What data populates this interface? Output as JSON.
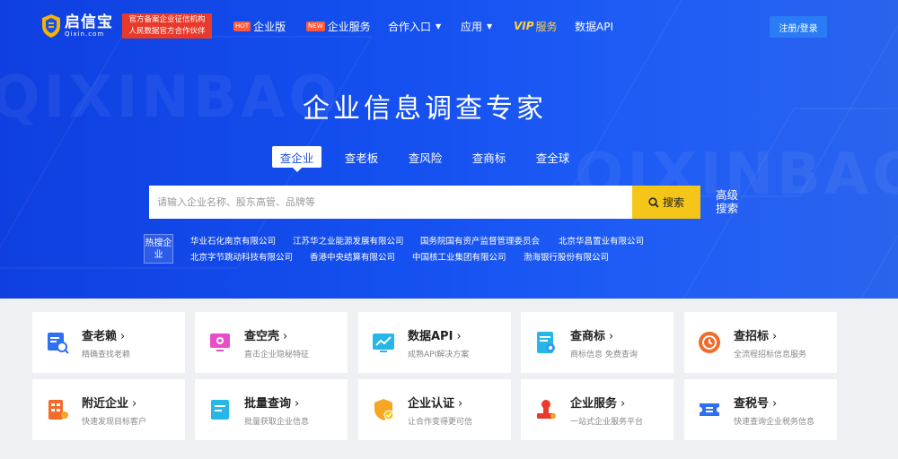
{
  "header": {
    "logo_cn": "启信宝",
    "logo_en": "Qixin.com",
    "tag_line1": "官方备案企业征信机构",
    "tag_line2": "人民数据官方合作伙伴",
    "nav": [
      {
        "badge": "HOT",
        "label": "企业版"
      },
      {
        "badge": "NEW",
        "label": "企业服务"
      },
      {
        "label": "合作入口"
      },
      {
        "label": "应用"
      },
      {
        "vip": "VIP",
        "label": "服务"
      },
      {
        "label": "数据API"
      }
    ],
    "login": "注册/登录"
  },
  "hero": {
    "title": "企业信息调查专家",
    "watermark1": "QIXINBAO",
    "watermark2": "QIXINBAO"
  },
  "tabs": [
    "查企业",
    "查老板",
    "查风险",
    "查商标",
    "查全球"
  ],
  "search": {
    "placeholder": "请输入企业名称、股东高管、品牌等",
    "button": "搜索",
    "advanced": "高级搜索"
  },
  "hot": {
    "tag": "热搜企业",
    "row1": [
      "华业石化南京有限公司",
      "江苏华之业能源发展有限公司",
      "国务院国有资产监督管理委员会",
      "北京华昌置业有限公司"
    ],
    "row2": [
      "北京字节跳动科技有限公司",
      "香港中央结算有限公司",
      "中国核工业集团有限公司",
      "渤海银行股份有限公司"
    ]
  },
  "cards": [
    {
      "title": "查老赖",
      "desc": "精确查找老赖",
      "icon": "person-search-icon"
    },
    {
      "title": "查空壳",
      "desc": "直击企业隐秘特征",
      "icon": "shell-monitor-icon"
    },
    {
      "title": "数据API",
      "desc": "成熟API解决方案",
      "icon": "chart-screen-icon"
    },
    {
      "title": "查商标",
      "desc": "商标信息 免费查询",
      "icon": "trademark-doc-icon"
    },
    {
      "title": "查招标",
      "desc": "全流程招标信息服务",
      "icon": "bid-clock-icon"
    },
    {
      "title": "附近企业",
      "desc": "快速发现目标客户",
      "icon": "nearby-building-icon"
    },
    {
      "title": "批量查询",
      "desc": "批量获取企业信息",
      "icon": "batch-doc-icon"
    },
    {
      "title": "企业认证",
      "desc": "让合作变得更可信",
      "icon": "shield-check-icon"
    },
    {
      "title": "企业服务",
      "desc": "一站式企业服务平台",
      "icon": "service-stamp-icon"
    },
    {
      "title": "查税号",
      "desc": "快速查询企业税务信息",
      "icon": "tax-ticket-icon"
    }
  ],
  "colors": {
    "hero": "#1550f0",
    "accent_yellow": "#f5c518",
    "tag_red": "#e8392b",
    "login_blue": "#2a7bf6"
  }
}
